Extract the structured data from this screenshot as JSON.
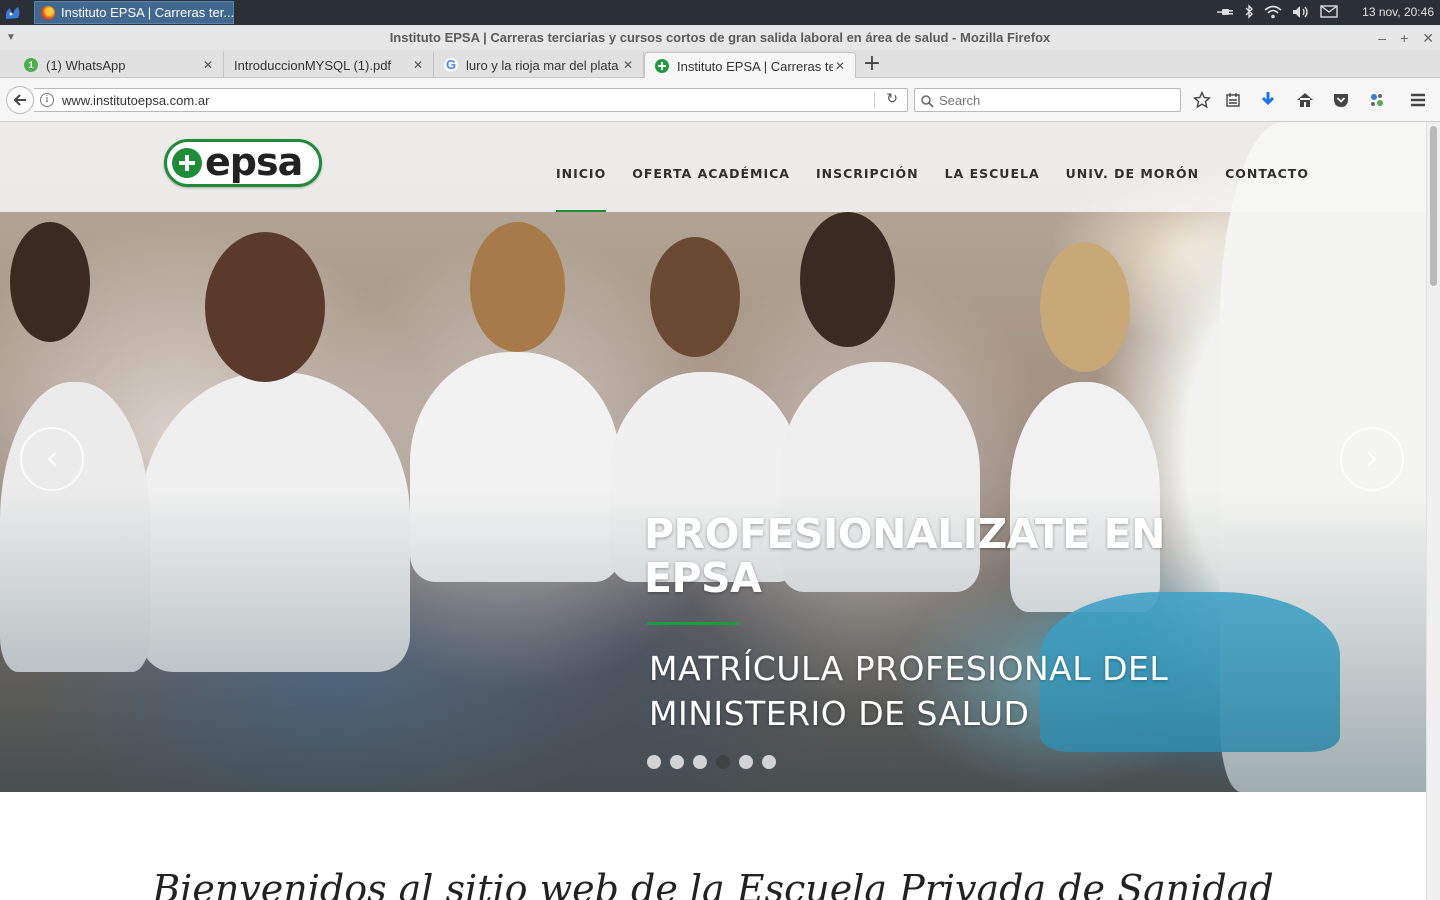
{
  "os": {
    "task_title": "Instituto EPSA | Carreras ter...",
    "clock": "13 nov, 20:46"
  },
  "window": {
    "title": "Instituto EPSA | Carreras terciarias y cursos cortos de gran salida laboral en área de salud - Mozilla Firefox"
  },
  "tabs": [
    {
      "label": "(1) WhatsApp",
      "badge": "1",
      "icon": "whatsapp-icon"
    },
    {
      "label": "IntroduccionMYSQL (1).pdf",
      "icon": ""
    },
    {
      "label": "luro y la rioja mar del plata",
      "icon": "google-icon"
    },
    {
      "label": "Instituto EPSA | Carreras terciarias",
      "icon": "epsa-icon",
      "active": true
    }
  ],
  "toolbar": {
    "url": "www.institutoepsa.com.ar",
    "search_placeholder": "Search"
  },
  "site": {
    "logo_text": "epsa",
    "nav": [
      {
        "label": "INICIO",
        "active": true
      },
      {
        "label": "OFERTA ACADÉMICA"
      },
      {
        "label": "INSCRIPCIÓN"
      },
      {
        "label": "LA ESCUELA"
      },
      {
        "label": "UNIV. DE MORÓN"
      },
      {
        "label": "CONTACTO"
      }
    ],
    "slider": {
      "title": "PROFESIONALIZATE EN EPSA",
      "subtitle": "MATRÍCULA PROFESIONAL DEL MINISTERIO DE SALUD",
      "slide_count": 6,
      "active_slide": 4,
      "prev_glyph": "‹",
      "next_glyph": "›"
    },
    "welcome": "Bienvenidos al sitio web de la Escuela Privada de Sanidad"
  },
  "colors": {
    "brand_green": "#1f8c3a",
    "os_panel": "#2b3036",
    "active_task": "#41688f"
  }
}
